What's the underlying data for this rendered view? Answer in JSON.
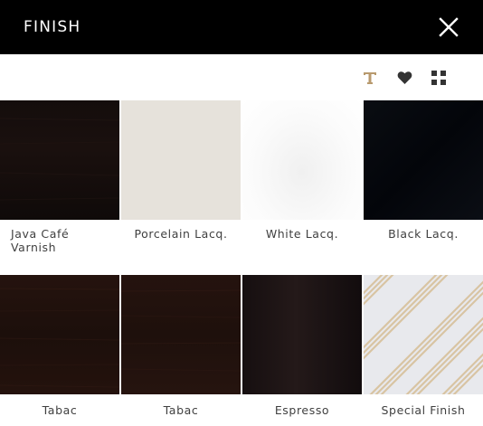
{
  "header": {
    "title": "FINISH",
    "close_icon": "close-icon"
  },
  "toolbar": {
    "icons": [
      "text-icon",
      "heart-icon",
      "grid-icon"
    ],
    "accent_color": "#b89a6e"
  },
  "finishes": [
    {
      "label": "Java Café Varnish",
      "color": "#120c0b"
    },
    {
      "label": "Porcelain Lacq.",
      "color": "#e7e3dc"
    },
    {
      "label": "White Lacq.",
      "color": "#f7f7f7"
    },
    {
      "label": "Black Lacq.",
      "color": "#05070b"
    },
    {
      "label": "Tabac",
      "color": "#1f100c"
    },
    {
      "label": "Tabac",
      "color": "#1f110d"
    },
    {
      "label": "Espresso",
      "color": "#1a1314"
    },
    {
      "label": "Special Finish",
      "color": "#e7e8ec",
      "stripe_color": "#d9c6a6"
    }
  ]
}
